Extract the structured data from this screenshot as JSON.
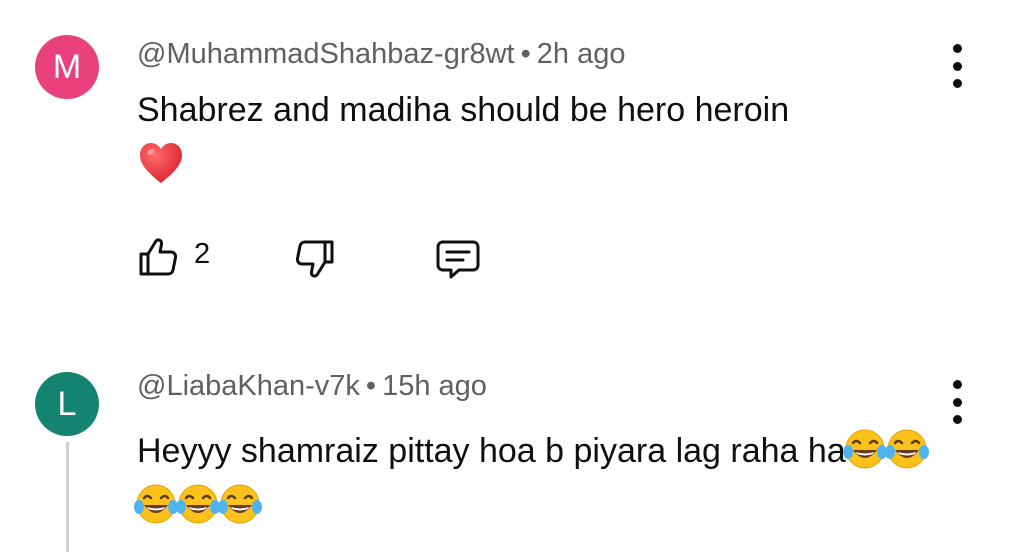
{
  "comments": [
    {
      "avatar_letter": "M",
      "avatar_color": "#e8417b",
      "handle": "@MuhammadShahbaz-gr8wt",
      "separator": "•",
      "time": "2h ago",
      "text": "Shabrez and madiha should be hero heroin",
      "emoji": "heart-emoji",
      "like_count": "2",
      "icons": [
        "like-icon",
        "dislike-icon",
        "reply-icon",
        "more-vert-icon"
      ]
    },
    {
      "avatar_letter": "L",
      "avatar_color": "#14836f",
      "handle": "@LiabaKhan-v7k",
      "separator": "•",
      "time": "15h ago",
      "text": "Heyyy shamraiz pittay hoa b piyara lag raha ha",
      "emoji": "tears-of-joy-emoji",
      "emoji_count": 5,
      "icons": [
        "more-vert-icon"
      ]
    }
  ]
}
